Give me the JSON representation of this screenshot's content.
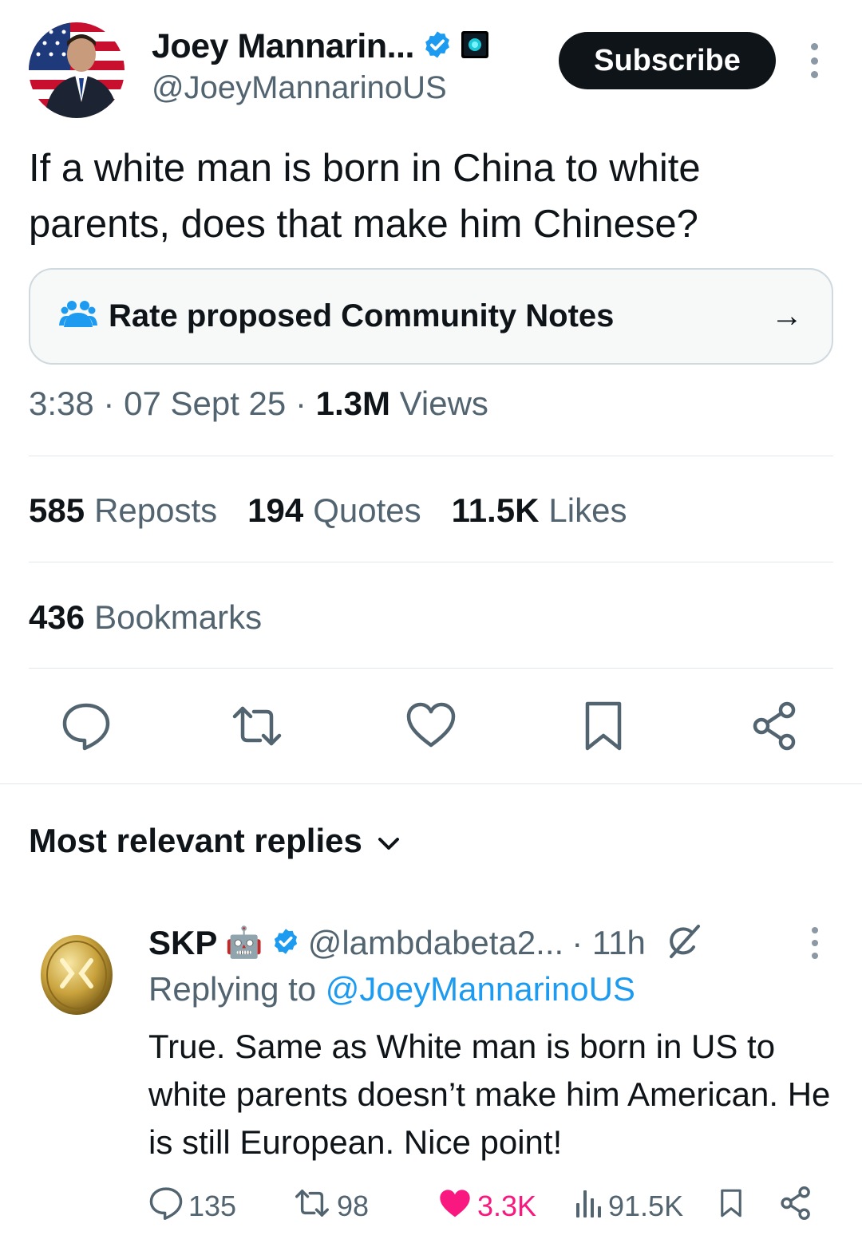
{
  "author": {
    "display_name": "Joey Mannarin...",
    "handle": "@JoeyMannarinoUS",
    "verified_icon": "verified-badge-icon",
    "affiliate_icon": "affiliate-badge-icon",
    "avatar": "avatar-flag-portrait"
  },
  "header": {
    "subscribe_label": "Subscribe"
  },
  "tweet": {
    "text": "If a white man is born in China to white parents, does that make him Chinese?",
    "time": "3:38",
    "date": "07 Sept 25",
    "views_count": "1.3M",
    "views_label": "Views",
    "sep": "·"
  },
  "community_notes": {
    "label": "Rate proposed Community Notes",
    "icon": "people-icon",
    "arrow": "→"
  },
  "stats": {
    "reposts_count": "585",
    "reposts_label": "Reposts",
    "quotes_count": "194",
    "quotes_label": "Quotes",
    "likes_count": "11.5K",
    "likes_label": "Likes",
    "bookmarks_count": "436",
    "bookmarks_label": "Bookmarks"
  },
  "actions": [
    "reply-icon",
    "repost-icon",
    "like-icon",
    "bookmark-icon",
    "share-icon"
  ],
  "replies_section": {
    "title": "Most relevant replies"
  },
  "reply": {
    "display_name": "SKP",
    "robot_emoji": "🤖",
    "handle": "@lambdabeta2...",
    "time": "· 11h",
    "replying_prefix": "Replying to",
    "replying_to": "@JoeyMannarinoUS",
    "text": "True. Same as White man is born in US to white parents doesn’t make him American. He is still European. Nice point!",
    "replies": "135",
    "reposts": "98",
    "likes": "3.3K",
    "views": "91.5K"
  },
  "colors": {
    "text_primary": "#0f1419",
    "text_secondary": "#536471",
    "accent": "#1d9bf0",
    "like": "#f91880",
    "border": "#cfd9de"
  }
}
